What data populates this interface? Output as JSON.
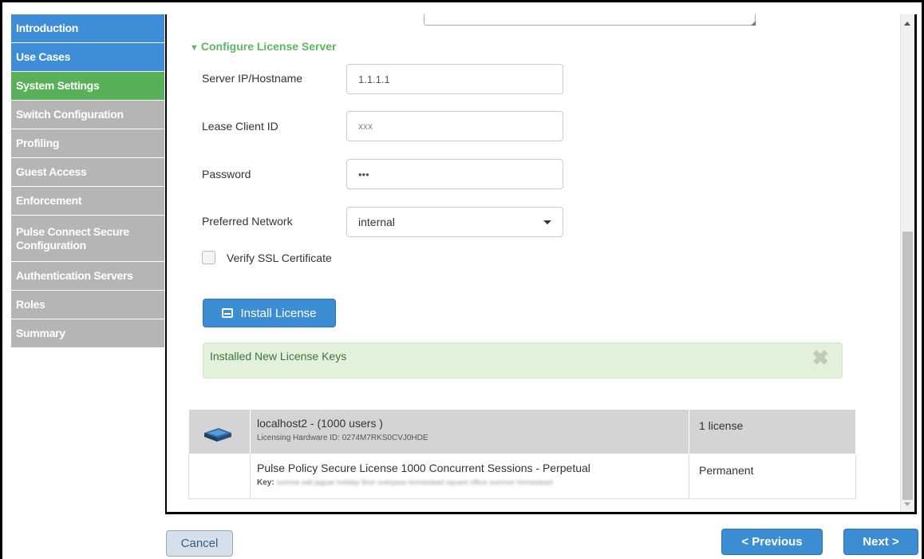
{
  "sidebar": {
    "items": [
      {
        "label": "Introduction",
        "state": "done"
      },
      {
        "label": "Use Cases",
        "state": "done"
      },
      {
        "label": "System Settings",
        "state": "active"
      },
      {
        "label": "Switch Configuration",
        "state": "todo"
      },
      {
        "label": "Profiling",
        "state": "todo"
      },
      {
        "label": "Guest Access",
        "state": "todo"
      },
      {
        "label": "Enforcement",
        "state": "todo"
      },
      {
        "label": "Pulse Connect Secure Configuration",
        "state": "todo"
      },
      {
        "label": "Authentication Servers",
        "state": "todo"
      },
      {
        "label": "Roles",
        "state": "todo"
      },
      {
        "label": "Summary",
        "state": "todo"
      }
    ]
  },
  "section": {
    "title": "Configure License Server"
  },
  "form": {
    "server": {
      "label": "Server IP/Hostname",
      "value": "1.1.1.1"
    },
    "client_id": {
      "label": "Lease Client ID",
      "value": "xxx"
    },
    "password": {
      "label": "Password",
      "value": "•••"
    },
    "network": {
      "label": "Preferred Network",
      "value": "internal"
    },
    "verify_ssl": {
      "label": "Verify SSL Certificate",
      "checked": false
    }
  },
  "install_button": {
    "label": "Install License",
    "icon": "inbox-icon"
  },
  "alert": {
    "text": "Installed New License Keys",
    "close_icon": "close-icon",
    "close_glyph": "✖"
  },
  "licenses": {
    "device": {
      "title": "localhost2 - (1000 users )",
      "hardware_id": "Licensing Hardware ID: 0274M7RKS0CVJ0HDE",
      "count": "1 license"
    },
    "item": {
      "title": "Pulse Policy Secure License 1000 Concurrent Sessions - Perpetual",
      "key_label": "Key:",
      "key_value": "sunrise salt jaguar holiday floor overpass homestead square office summer homestead",
      "term": "Permanent"
    }
  },
  "footer": {
    "cancel": "Cancel",
    "previous": "< Previous",
    "next": "Next >"
  },
  "colors": {
    "primary": "#3c8dd2",
    "done": "#3d8ed6",
    "active": "#58b058",
    "todo": "#b5b5b5",
    "success_bg": "#e3f1dc"
  }
}
